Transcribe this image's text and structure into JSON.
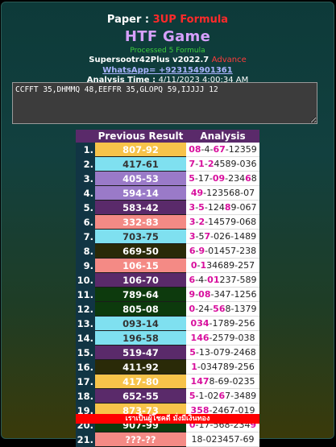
{
  "header": {
    "paper_label": "Paper :",
    "paper_value": "3UP Formula",
    "title": "HTF Game",
    "processed": "Processed 5 Formula",
    "version_main": "Supersootr42Plus v2022.7",
    "version_tag": "Advance",
    "whatsapp": "WhatsApp= +923154901361",
    "time_label": "Analysis Time :",
    "time_value": "4/11/2023 4:00:34 AM"
  },
  "input": {
    "value": "CCFFT 35,DHMMQ 48,EEFFR 35,GLOPQ 59,IJJJJ 12"
  },
  "table": {
    "headers": [
      "Previous Result",
      "Analysis"
    ],
    "rows": [
      {
        "num": "1.",
        "result": "807-92",
        "bg": "#f7c34a",
        "fg": "#ffffff",
        "analysis": "08-4-67-12359",
        "hl": [
          0,
          1,
          5,
          6
        ]
      },
      {
        "num": "2.",
        "result": "417-61",
        "bg": "#7fe0f0",
        "fg": "#333333",
        "analysis": "7-1-24589-036",
        "hl": [
          0,
          2,
          4
        ]
      },
      {
        "num": "3.",
        "result": "405-53",
        "bg": "#9a7ac8",
        "fg": "#ffffff",
        "analysis": "5-17-09-23468",
        "hl": [
          0,
          5,
          6,
          11
        ]
      },
      {
        "num": "4.",
        "result": "594-14",
        "bg": "#9a7ac8",
        "fg": "#ffffff",
        "analysis": "49-123568-07",
        "hl": [
          0,
          1
        ]
      },
      {
        "num": "5.",
        "result": "583-42",
        "bg": "#5a2a6a",
        "fg": "#ffffff",
        "analysis": "3-5-12489-067",
        "hl": [
          0,
          2,
          7
        ]
      },
      {
        "num": "6.",
        "result": "332-83",
        "bg": "#f48a85",
        "fg": "#ffffff",
        "analysis": "3-2-14579-068",
        "hl": [
          0,
          2
        ]
      },
      {
        "num": "7.",
        "result": "703-75",
        "bg": "#7fe0f0",
        "fg": "#333333",
        "analysis": "3-57-026-1489",
        "hl": [
          0,
          3
        ]
      },
      {
        "num": "8.",
        "result": "669-50",
        "bg": "#2a2a08",
        "fg": "#ffffff",
        "analysis": "6-9-01457-238",
        "hl": [
          0,
          2
        ]
      },
      {
        "num": "9.",
        "result": "106-15",
        "bg": "#f48a85",
        "fg": "#ffffff",
        "analysis": "0-134689-257",
        "hl": [
          0,
          2
        ]
      },
      {
        "num": "10.",
        "result": "106-70",
        "bg": "#5a2a6a",
        "fg": "#ffffff",
        "analysis": "6-4-01237-589",
        "hl": [
          0,
          4,
          5
        ]
      },
      {
        "num": "11.",
        "result": "789-64",
        "bg": "#0d3a0d",
        "fg": "#ffffff",
        "analysis": "9-08-347-1256",
        "hl": [
          0,
          2,
          3
        ]
      },
      {
        "num": "12.",
        "result": "805-08",
        "bg": "#0d3a0d",
        "fg": "#ffffff",
        "analysis": "0-24-568-1379",
        "hl": [
          0,
          5,
          6
        ]
      },
      {
        "num": "13.",
        "result": "093-14",
        "bg": "#7fe0f0",
        "fg": "#333333",
        "analysis": "034-1789-256",
        "hl": [
          0,
          1,
          2
        ]
      },
      {
        "num": "14.",
        "result": "196-58",
        "bg": "#7fe0f0",
        "fg": "#333333",
        "analysis": "146-2579-038",
        "hl": [
          0,
          1,
          2
        ]
      },
      {
        "num": "15.",
        "result": "519-47",
        "bg": "#5a2a6a",
        "fg": "#ffffff",
        "analysis": "5-13-079-2468",
        "hl": [
          0
        ]
      },
      {
        "num": "16.",
        "result": "411-92",
        "bg": "#2a2a08",
        "fg": "#ffffff",
        "analysis": "1-034789-256",
        "hl": [
          0
        ]
      },
      {
        "num": "17.",
        "result": "417-80",
        "bg": "#f7c34a",
        "fg": "#ffffff",
        "analysis": "1478-69-0235",
        "hl": [
          0,
          1,
          2
        ]
      },
      {
        "num": "18.",
        "result": "652-55",
        "bg": "#5a2a6a",
        "fg": "#ffffff",
        "analysis": "5-1-0267-3489",
        "hl": [
          0,
          6
        ]
      },
      {
        "num": "19.",
        "result": "873-73",
        "bg": "#f7c34a",
        "fg": "#ffffff",
        "analysis": "358-2467-019",
        "hl": [
          0,
          1,
          2
        ]
      },
      {
        "num": "20.",
        "result": "907-99",
        "bg": "#0d3a0d",
        "fg": "#ffffff",
        "analysis": "0-17-568-2349",
        "hl": [
          0,
          12
        ]
      },
      {
        "num": "21.",
        "result": "???-??",
        "bg": "#f48a85",
        "fg": "#ffffff",
        "analysis": "18-023457-69",
        "hl": []
      }
    ]
  },
  "footer": "เราเป็นผู้โชคดี มั่งมีเงินทอง"
}
